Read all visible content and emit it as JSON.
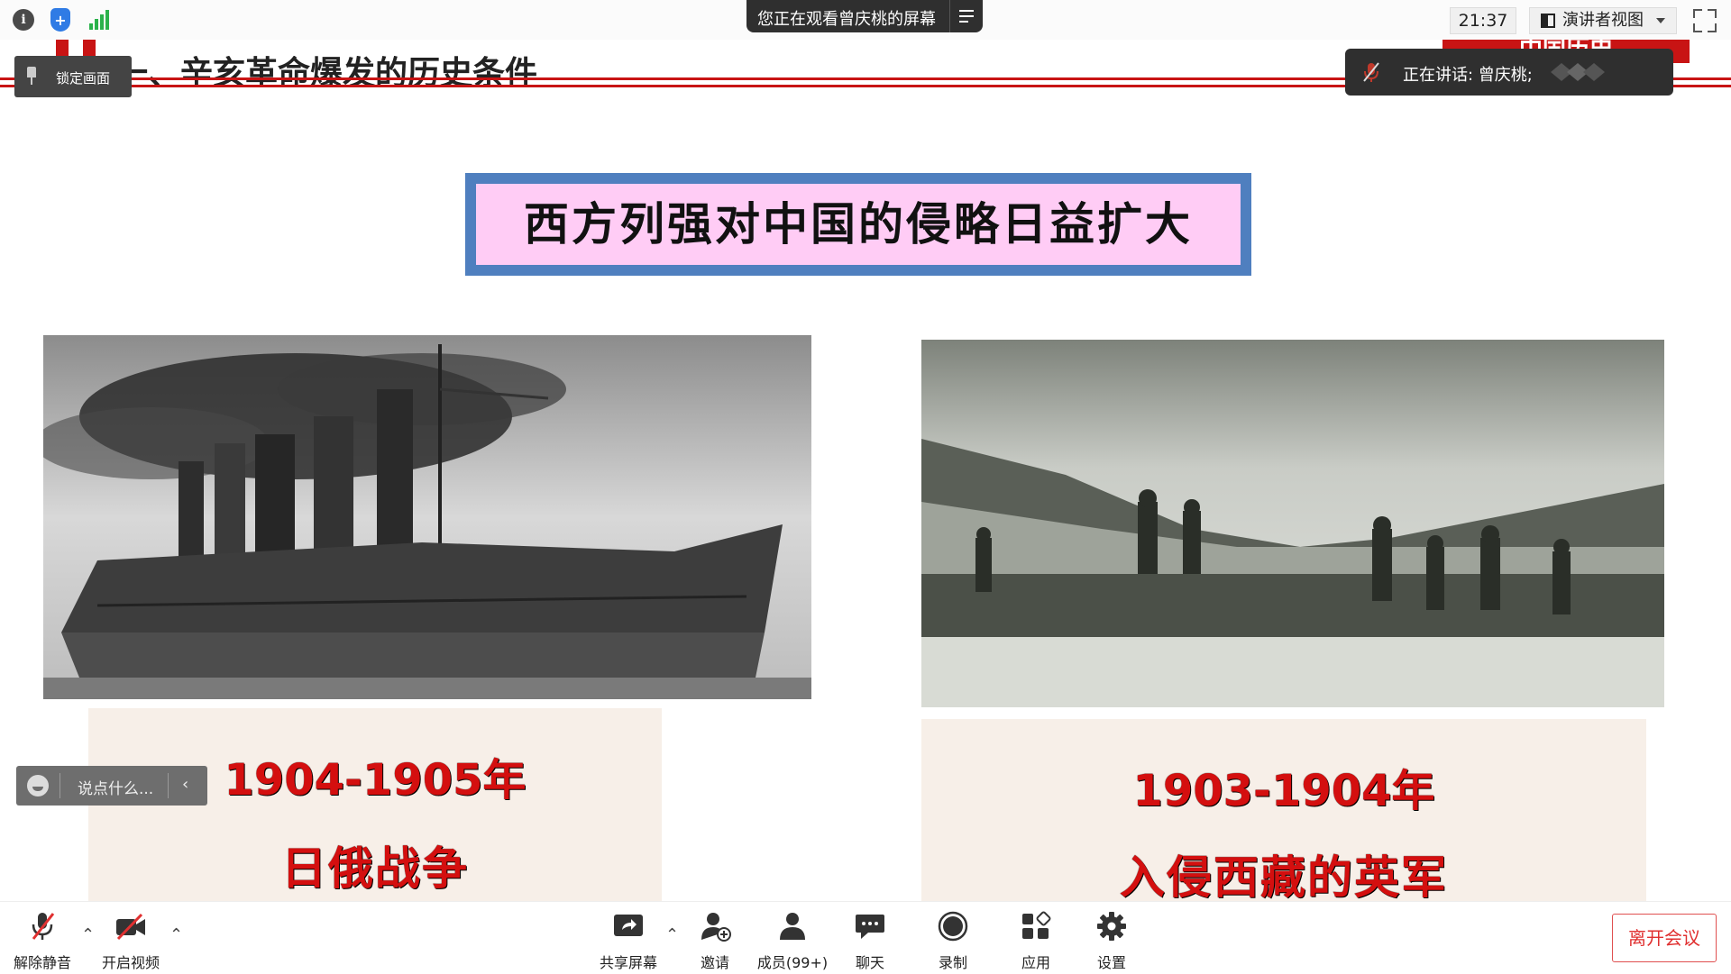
{
  "topbar": {
    "share_notice": "您正在观看曾庆桃的屏幕",
    "clock": "21:37",
    "view_mode": "演讲者视图"
  },
  "slide": {
    "heading": "一、辛亥革命爆发的历史条件",
    "badge": "中国历史",
    "title": "西方列强对中国的侵略日益扩大",
    "captions": [
      {
        "years": "1904-1905年",
        "event": "日俄战争"
      },
      {
        "years": "1903-1904年",
        "event": "入侵西藏的英军"
      }
    ]
  },
  "lock_view": {
    "label": "锁定画面"
  },
  "speaker": {
    "label": "正在讲话: 曾庆桃;"
  },
  "chat": {
    "placeholder": "说点什么..."
  },
  "toolbar": {
    "unmute": "解除静音",
    "start_video": "开启视频",
    "share_screen": "共享屏幕",
    "invite": "邀请",
    "members": "成员(99+)",
    "chat": "聊天",
    "record": "录制",
    "apps": "应用",
    "settings": "设置",
    "leave": "离开会议"
  },
  "colors": {
    "accent_red": "#c81414",
    "title_border": "#4f7fbf",
    "title_bg": "#ffccf5",
    "caption_red": "#d40f0f",
    "signal_green": "#2ab24b"
  }
}
